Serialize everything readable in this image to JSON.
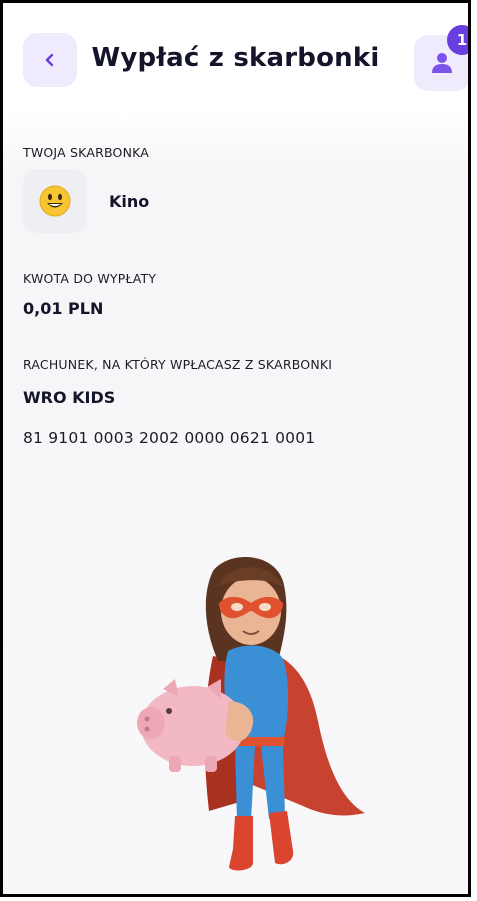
{
  "header": {
    "title": "Wypłać z skarbonki",
    "notification_count": "1",
    "back_icon": "chevron-left-icon",
    "profile_icon": "user-icon"
  },
  "piggybank": {
    "section_label": "TWOJA SKARBONKA",
    "emoji": "😀",
    "name": "Kino"
  },
  "amount": {
    "label": "KWOTA DO WYPŁATY",
    "value": "0,01 PLN"
  },
  "account": {
    "label": "RACHUNEK, NA KTÓRY WPŁACASZ Z SKARBONKI",
    "owner": "WRO KIDS",
    "number": "81 9101 0003 2002 0000 0621 0001"
  },
  "colors": {
    "accent": "#6a3de0",
    "accent_soft": "#efeafc",
    "text": "#14142a"
  }
}
